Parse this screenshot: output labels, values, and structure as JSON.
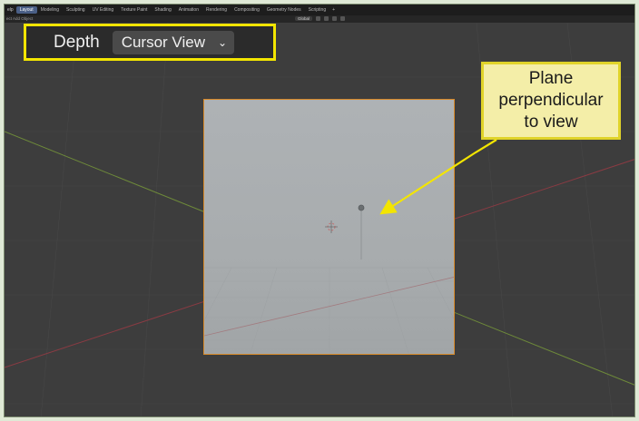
{
  "topbar": {
    "help_label": "elp",
    "workspaces": [
      "Layout",
      "Modeling",
      "Sculpting",
      "UV Editing",
      "Texture Paint",
      "Shading",
      "Animation",
      "Rendering",
      "Compositing",
      "Geometry Nodes",
      "Scripting"
    ],
    "add_label": "+"
  },
  "subbar": {
    "left_label": "ect Add Object",
    "orientation_label": "Global"
  },
  "header_widget": {
    "depth_label": "Depth",
    "depth_value": "Cursor View",
    "chevron": "⌄"
  },
  "callout": {
    "lines": [
      "Plane",
      "perpendicular",
      "to view"
    ]
  },
  "colors": {
    "highlight": "#f3e500",
    "callout_bg": "#f4eea8",
    "plane_outline": "#d88a2a",
    "viewport_bg": "#3d3d3d"
  }
}
